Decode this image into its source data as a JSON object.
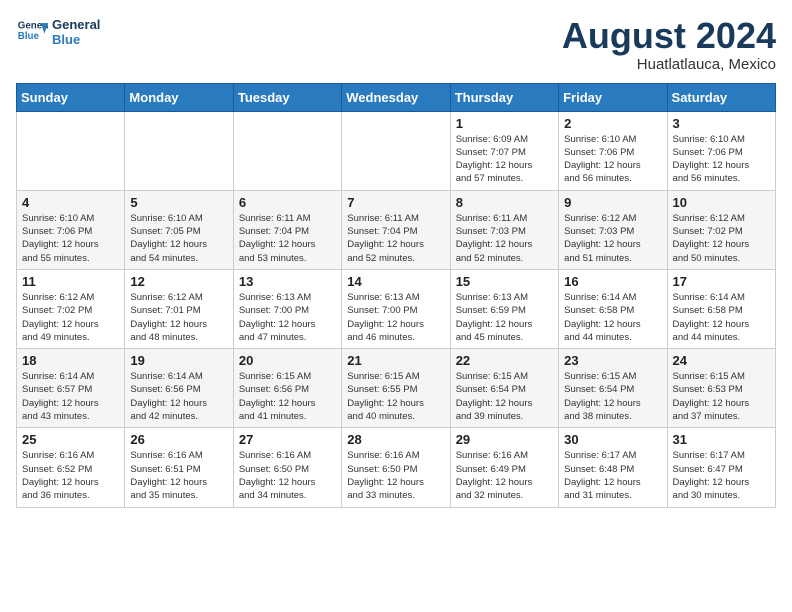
{
  "header": {
    "logo_general": "General",
    "logo_blue": "Blue",
    "month_title": "August 2024",
    "location": "Huatlatlauca, Mexico"
  },
  "days_of_week": [
    "Sunday",
    "Monday",
    "Tuesday",
    "Wednesday",
    "Thursday",
    "Friday",
    "Saturday"
  ],
  "weeks": [
    [
      {
        "day": "",
        "info": ""
      },
      {
        "day": "",
        "info": ""
      },
      {
        "day": "",
        "info": ""
      },
      {
        "day": "",
        "info": ""
      },
      {
        "day": "1",
        "info": "Sunrise: 6:09 AM\nSunset: 7:07 PM\nDaylight: 12 hours\nand 57 minutes."
      },
      {
        "day": "2",
        "info": "Sunrise: 6:10 AM\nSunset: 7:06 PM\nDaylight: 12 hours\nand 56 minutes."
      },
      {
        "day": "3",
        "info": "Sunrise: 6:10 AM\nSunset: 7:06 PM\nDaylight: 12 hours\nand 56 minutes."
      }
    ],
    [
      {
        "day": "4",
        "info": "Sunrise: 6:10 AM\nSunset: 7:06 PM\nDaylight: 12 hours\nand 55 minutes."
      },
      {
        "day": "5",
        "info": "Sunrise: 6:10 AM\nSunset: 7:05 PM\nDaylight: 12 hours\nand 54 minutes."
      },
      {
        "day": "6",
        "info": "Sunrise: 6:11 AM\nSunset: 7:04 PM\nDaylight: 12 hours\nand 53 minutes."
      },
      {
        "day": "7",
        "info": "Sunrise: 6:11 AM\nSunset: 7:04 PM\nDaylight: 12 hours\nand 52 minutes."
      },
      {
        "day": "8",
        "info": "Sunrise: 6:11 AM\nSunset: 7:03 PM\nDaylight: 12 hours\nand 52 minutes."
      },
      {
        "day": "9",
        "info": "Sunrise: 6:12 AM\nSunset: 7:03 PM\nDaylight: 12 hours\nand 51 minutes."
      },
      {
        "day": "10",
        "info": "Sunrise: 6:12 AM\nSunset: 7:02 PM\nDaylight: 12 hours\nand 50 minutes."
      }
    ],
    [
      {
        "day": "11",
        "info": "Sunrise: 6:12 AM\nSunset: 7:02 PM\nDaylight: 12 hours\nand 49 minutes."
      },
      {
        "day": "12",
        "info": "Sunrise: 6:12 AM\nSunset: 7:01 PM\nDaylight: 12 hours\nand 48 minutes."
      },
      {
        "day": "13",
        "info": "Sunrise: 6:13 AM\nSunset: 7:00 PM\nDaylight: 12 hours\nand 47 minutes."
      },
      {
        "day": "14",
        "info": "Sunrise: 6:13 AM\nSunset: 7:00 PM\nDaylight: 12 hours\nand 46 minutes."
      },
      {
        "day": "15",
        "info": "Sunrise: 6:13 AM\nSunset: 6:59 PM\nDaylight: 12 hours\nand 45 minutes."
      },
      {
        "day": "16",
        "info": "Sunrise: 6:14 AM\nSunset: 6:58 PM\nDaylight: 12 hours\nand 44 minutes."
      },
      {
        "day": "17",
        "info": "Sunrise: 6:14 AM\nSunset: 6:58 PM\nDaylight: 12 hours\nand 44 minutes."
      }
    ],
    [
      {
        "day": "18",
        "info": "Sunrise: 6:14 AM\nSunset: 6:57 PM\nDaylight: 12 hours\nand 43 minutes."
      },
      {
        "day": "19",
        "info": "Sunrise: 6:14 AM\nSunset: 6:56 PM\nDaylight: 12 hours\nand 42 minutes."
      },
      {
        "day": "20",
        "info": "Sunrise: 6:15 AM\nSunset: 6:56 PM\nDaylight: 12 hours\nand 41 minutes."
      },
      {
        "day": "21",
        "info": "Sunrise: 6:15 AM\nSunset: 6:55 PM\nDaylight: 12 hours\nand 40 minutes."
      },
      {
        "day": "22",
        "info": "Sunrise: 6:15 AM\nSunset: 6:54 PM\nDaylight: 12 hours\nand 39 minutes."
      },
      {
        "day": "23",
        "info": "Sunrise: 6:15 AM\nSunset: 6:54 PM\nDaylight: 12 hours\nand 38 minutes."
      },
      {
        "day": "24",
        "info": "Sunrise: 6:15 AM\nSunset: 6:53 PM\nDaylight: 12 hours\nand 37 minutes."
      }
    ],
    [
      {
        "day": "25",
        "info": "Sunrise: 6:16 AM\nSunset: 6:52 PM\nDaylight: 12 hours\nand 36 minutes."
      },
      {
        "day": "26",
        "info": "Sunrise: 6:16 AM\nSunset: 6:51 PM\nDaylight: 12 hours\nand 35 minutes."
      },
      {
        "day": "27",
        "info": "Sunrise: 6:16 AM\nSunset: 6:50 PM\nDaylight: 12 hours\nand 34 minutes."
      },
      {
        "day": "28",
        "info": "Sunrise: 6:16 AM\nSunset: 6:50 PM\nDaylight: 12 hours\nand 33 minutes."
      },
      {
        "day": "29",
        "info": "Sunrise: 6:16 AM\nSunset: 6:49 PM\nDaylight: 12 hours\nand 32 minutes."
      },
      {
        "day": "30",
        "info": "Sunrise: 6:17 AM\nSunset: 6:48 PM\nDaylight: 12 hours\nand 31 minutes."
      },
      {
        "day": "31",
        "info": "Sunrise: 6:17 AM\nSunset: 6:47 PM\nDaylight: 12 hours\nand 30 minutes."
      }
    ]
  ]
}
